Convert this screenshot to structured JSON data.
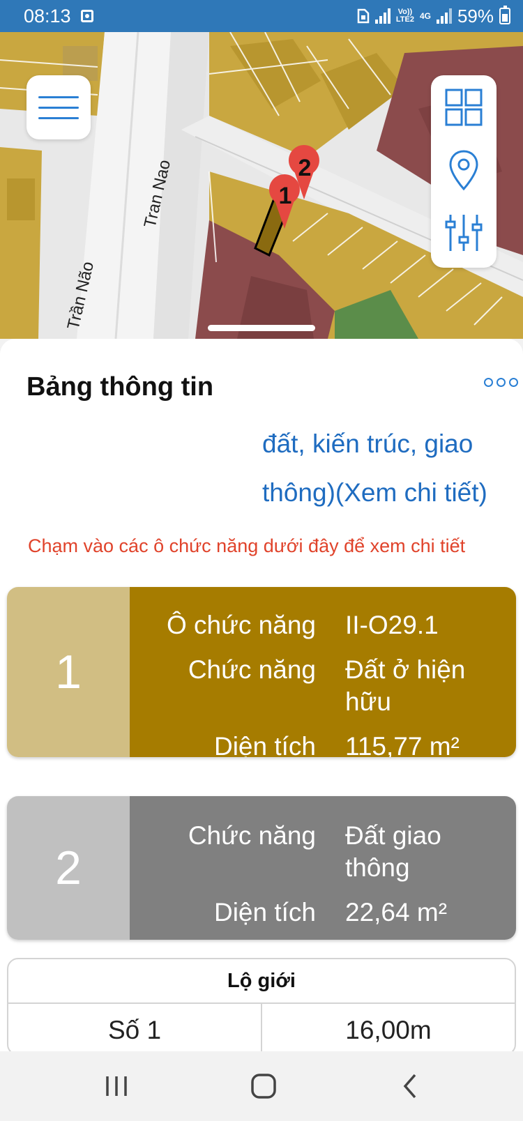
{
  "status": {
    "time": "08:13",
    "net_label_top": "Vo))",
    "net_label_bottom": "LTE2",
    "net_4g": "4G",
    "battery": "59%"
  },
  "map": {
    "street_1": "Tran Nao",
    "street_2": "Trần Não",
    "marker_1": "1",
    "marker_2": "2",
    "colors": {
      "residential": "#c9a740",
      "commercial": "#8b4b4c",
      "road": "#ececec",
      "green": "#5b8d4a"
    }
  },
  "toolbar": {
    "menu_icon": "hamburger-icon",
    "layers_icon": "grid-icon",
    "location_icon": "location-pin-icon",
    "filter_icon": "sliders-icon"
  },
  "panel": {
    "title": "Bảng thông tin",
    "desc_line1": "đất, kiến trúc, giao",
    "desc_line2": "thông)(Xem chi tiết)",
    "hint": "Chạm vào các ô chức năng dưới đây để xem chi tiết",
    "cards": [
      {
        "number": "1",
        "rows": [
          {
            "key": "Ô chức năng",
            "value": "II-O29.1"
          },
          {
            "key": "Chức năng",
            "value": "Đất ở hiện hữu"
          },
          {
            "key": "Diện tích",
            "value": "115,77 m²"
          }
        ]
      },
      {
        "number": "2",
        "rows": [
          {
            "key": "Chức năng",
            "value": "Đất giao thông"
          },
          {
            "key": "Diện tích",
            "value": "22,64 m²"
          }
        ]
      }
    ],
    "lo_gioi": {
      "header": "Lộ giới",
      "rows": [
        {
          "name": "Số 1",
          "value": "16,00m"
        }
      ]
    }
  }
}
